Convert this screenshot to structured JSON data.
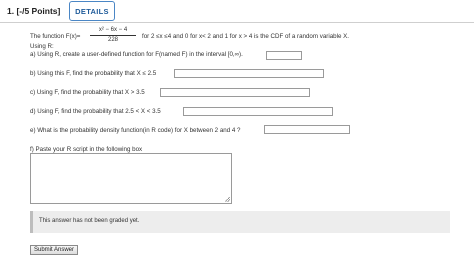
{
  "header": {
    "question_title": "1.  [-/5 Points]",
    "details_label": "DETAILS"
  },
  "question": {
    "fn_prefix": "The function F(x)=",
    "fn_numerator": "x² − 6x − 4",
    "fn_denominator": "228",
    "fn_suffix": "for 2 ≤x ≤4 and 0 for x< 2 and 1 for x > 4 is the CDF of a random variable X.",
    "using_r": "Using R:",
    "a_text": "a) Using R, create a user-defined function for F(named F) in the interval [0,∞).",
    "b_text": "b) Using this F, find the probability that X ≤ 2.5",
    "c_text": "c) Using F, find the probability that X > 3.5",
    "d_text": "d) Using F, find the probability that 2.5 < X < 3.5",
    "e_text": "e) What is the probability density function(in R code) for X between 2 and 4 ?",
    "f_text": "f) Paste your R script in the following box"
  },
  "inputs": {
    "a_value": "",
    "b_value": "",
    "c_value": "",
    "d_value": "",
    "e_value": "",
    "script_value": ""
  },
  "status": {
    "graded_message": "This answer has not been graded yet."
  },
  "actions": {
    "submit_label": "Submit Answer"
  }
}
